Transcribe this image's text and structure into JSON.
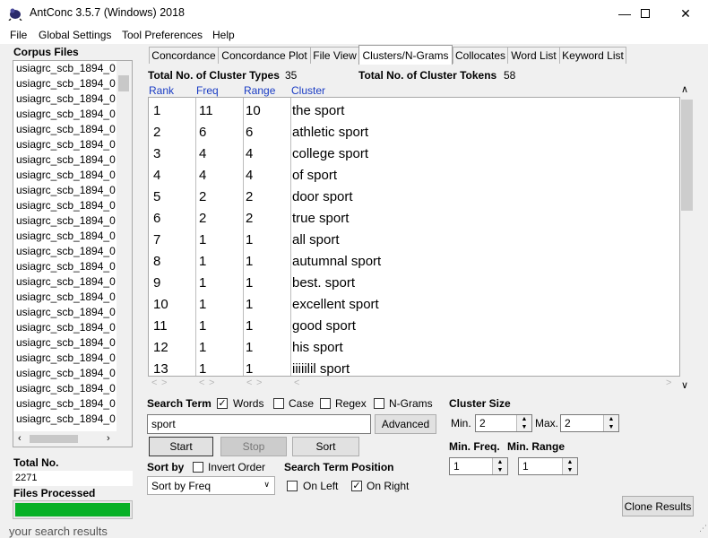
{
  "window": {
    "title": "AntConc 3.5.7 (Windows) 2018"
  },
  "menu": [
    "File",
    "Global Settings",
    "Tool Preferences",
    "Help"
  ],
  "tabs": [
    "Concordance",
    "Concordance Plot",
    "File View",
    "Clusters/N-Grams",
    "Collocates",
    "Word List",
    "Keyword List"
  ],
  "active_tab": "Clusters/N-Grams",
  "corpus": {
    "label": "Corpus Files",
    "files": [
      "usiagrc_scb_1894_0",
      "usiagrc_scb_1894_0",
      "usiagrc_scb_1894_0",
      "usiagrc_scb_1894_0",
      "usiagrc_scb_1894_0",
      "usiagrc_scb_1894_0",
      "usiagrc_scb_1894_0",
      "usiagrc_scb_1894_0",
      "usiagrc_scb_1894_0",
      "usiagrc_scb_1894_0",
      "usiagrc_scb_1894_0",
      "usiagrc_scb_1894_0",
      "usiagrc_scb_1894_0",
      "usiagrc_scb_1894_0",
      "usiagrc_scb_1894_0",
      "usiagrc_scb_1894_0",
      "usiagrc_scb_1894_0",
      "usiagrc_scb_1894_0",
      "usiagrc_scb_1894_0",
      "usiagrc_scb_1894_0",
      "usiagrc_scb_1894_0",
      "usiagrc_scb_1894_0",
      "usiagrc_scb_1894_0",
      "usiagrc_scb_1894_0"
    ],
    "total_label": "Total No.",
    "total_value": "2271",
    "processed_label": "Files Processed",
    "progress": 1.0
  },
  "stats": {
    "types_label": "Total No. of Cluster Types",
    "types_value": "35",
    "tokens_label": "Total No. of Cluster Tokens",
    "tokens_value": "58"
  },
  "columns": [
    "Rank",
    "Freq",
    "Range",
    "Cluster"
  ],
  "rows": [
    [
      "1",
      "11",
      "10",
      "the sport"
    ],
    [
      "2",
      "6",
      "6",
      "athletic sport"
    ],
    [
      "3",
      "4",
      "4",
      "college sport"
    ],
    [
      "4",
      "4",
      "4",
      "of sport"
    ],
    [
      "5",
      "2",
      "2",
      "door sport"
    ],
    [
      "6",
      "2",
      "2",
      "true sport"
    ],
    [
      "7",
      "1",
      "1",
      "all sport"
    ],
    [
      "8",
      "1",
      "1",
      "autumnal sport"
    ],
    [
      "9",
      "1",
      "1",
      "best.  sport"
    ],
    [
      "10",
      "1",
      "1",
      "excellent sport"
    ],
    [
      "11",
      "1",
      "1",
      "good sport"
    ],
    [
      "12",
      "1",
      "1",
      "his sport"
    ],
    [
      "13",
      "1",
      "1",
      "iiiiilil sport"
    ]
  ],
  "search": {
    "label": "Search Term",
    "words_label": "Words",
    "words_checked": true,
    "case_label": "Case",
    "case_checked": false,
    "regex_label": "Regex",
    "regex_checked": false,
    "ngrams_label": "N-Grams",
    "ngrams_checked": false,
    "value": "sport",
    "advanced_label": "Advanced"
  },
  "buttons": {
    "start": "Start",
    "stop": "Stop",
    "sort": "Sort",
    "clone": "Clone Results"
  },
  "sort": {
    "label": "Sort by",
    "invert_label": "Invert Order",
    "invert_checked": false,
    "selected": "Sort by Freq"
  },
  "position": {
    "label": "Search Term Position",
    "left_label": "On Left",
    "left_checked": false,
    "right_label": "On Right",
    "right_checked": true
  },
  "cluster_size": {
    "label": "Cluster Size",
    "min_label": "Min.",
    "min_value": "2",
    "max_label": "Max.",
    "max_value": "2"
  },
  "min_freq": {
    "label": "Min. Freq.",
    "value": "1"
  },
  "min_range": {
    "label": "Min. Range",
    "value": "1"
  },
  "background_text": "your search results",
  "colors": {
    "progress": "#06b025",
    "header_blue": "#1a3cc4"
  }
}
